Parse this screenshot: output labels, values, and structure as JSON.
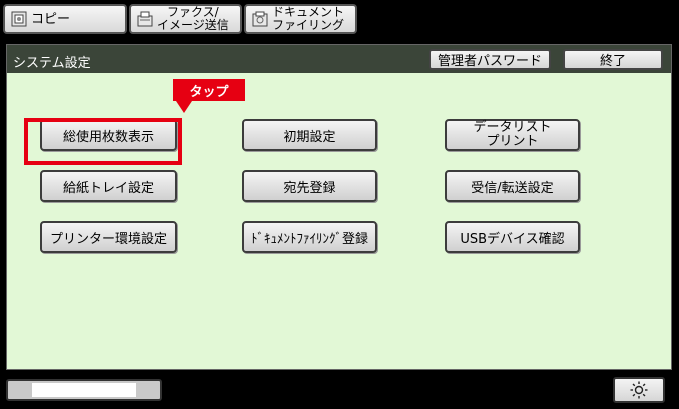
{
  "tabs": {
    "copy": "コピー",
    "fax_line1": "ファクス/",
    "fax_line2": "イメージ送信",
    "doc_line1": "ドキュメント",
    "doc_line2": "ファイリング"
  },
  "panel": {
    "title": "システム設定",
    "admin_password": "管理者パスワード",
    "exit": "終了"
  },
  "buttons": {
    "total_count": "総使用枚数表示",
    "initial_settings": "初期設定",
    "data_list_print": "データリスト\nプリント",
    "paper_tray_settings": "給紙トレイ設定",
    "address_registration": "宛先登録",
    "rx_forward_settings": "受信/転送設定",
    "printer_env_settings": "プリンター環境設定",
    "doc_filing_registration": "ﾄﾞｷｭﾒﾝﾄﾌｧｲﾘﾝｸﾞ登録",
    "usb_device_check": "USBデバイス確認"
  },
  "annotation": {
    "tap_label": "タップ",
    "highlight_color": "#e60012"
  },
  "icons": {
    "copy": "copy-icon",
    "fax": "fax-icon",
    "doc": "document-filing-icon",
    "brightness": "brightness-icon"
  }
}
